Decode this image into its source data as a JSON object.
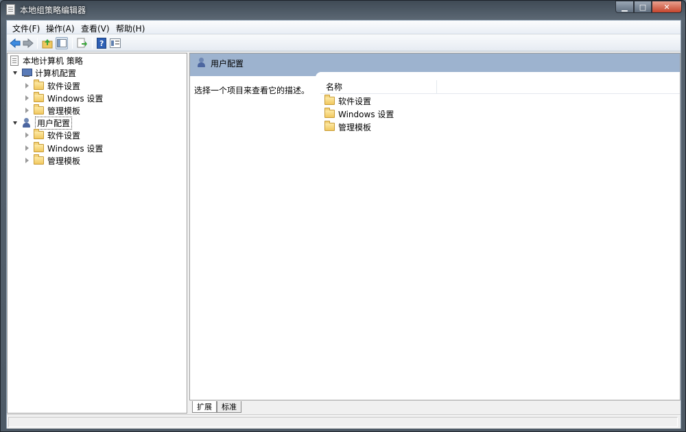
{
  "window": {
    "title": "本地组策略编辑器",
    "caption": {
      "minimize": "▁",
      "maximize": "□",
      "close": "✕"
    }
  },
  "menu": [
    "文件(F)",
    "操作(A)",
    "查看(V)",
    "帮助(H)"
  ],
  "toolbar": {
    "back": "back-icon",
    "forward": "forward-icon",
    "up": "up-folder-icon",
    "show_hide_tree": "console-tree-icon",
    "export": "export-list-icon",
    "help": "help-icon",
    "properties": "properties-icon"
  },
  "tree": {
    "root": "本地计算机 策略",
    "computer_config": "计算机配置",
    "computer_children": [
      "软件设置",
      "Windows 设置",
      "管理模板"
    ],
    "user_config": "用户配置",
    "user_children": [
      "软件设置",
      "Windows 设置",
      "管理模板"
    ]
  },
  "right": {
    "header_title": "用户配置",
    "description": "选择一个项目来查看它的描述。",
    "column_name": "名称",
    "items": [
      "软件设置",
      "Windows 设置",
      "管理模板"
    ]
  },
  "tabs": [
    "扩展",
    "标准"
  ],
  "status": "",
  "colors": {
    "header_blue": "#9db3cf",
    "folder": "#f1c85f",
    "close_button": "#c6452c"
  }
}
